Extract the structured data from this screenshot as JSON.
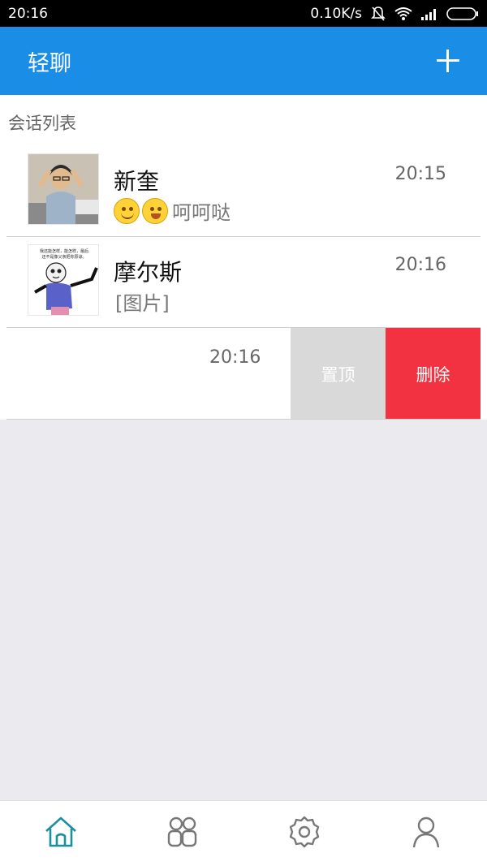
{
  "status_bar": {
    "time": "20:16",
    "speed": "0.10K/s"
  },
  "app_bar": {
    "title": "轻聊",
    "add_icon": "plus-icon"
  },
  "section": {
    "label": "会话列表"
  },
  "conversations": [
    {
      "name": "新奎",
      "time": "20:15",
      "preview_text": "呵呵哒",
      "preview_emojis": [
        "smile-emoji",
        "grin-emoji"
      ]
    },
    {
      "name": "摩尔斯",
      "time": "20:16",
      "preview_text": "[图片]",
      "avatar_caption": "我还能怎样，能怎样，最后\n还不是像父亲把你原谅。"
    },
    {
      "name": "",
      "time": "20:16",
      "actions": {
        "pin_label": "置顶",
        "delete_label": "删除"
      }
    }
  ],
  "bottom_nav": [
    {
      "icon": "home-icon",
      "active": true
    },
    {
      "icon": "contacts-icon",
      "active": false
    },
    {
      "icon": "settings-icon",
      "active": false
    },
    {
      "icon": "profile-icon",
      "active": false
    }
  ],
  "colors": {
    "primary": "#1a8ee6",
    "delete": "#f23240",
    "pin": "#d9d9d9",
    "active_nav": "#1a8fa0",
    "inactive_nav": "#777777"
  }
}
